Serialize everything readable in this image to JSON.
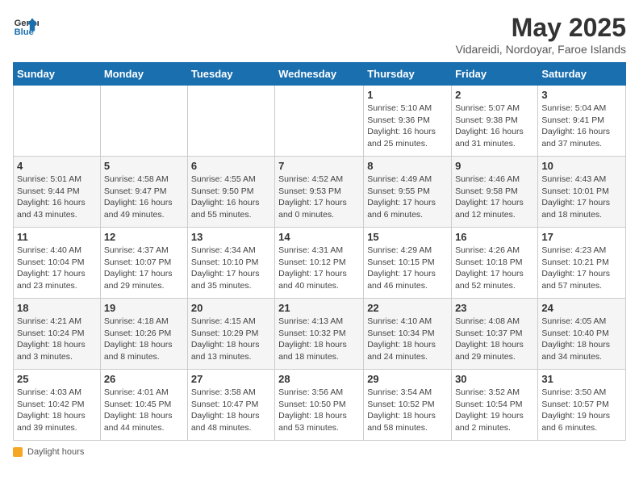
{
  "logo": {
    "line1": "General",
    "line2": "Blue"
  },
  "title": "May 2025",
  "subtitle": "Vidareidi, Nordoyar, Faroe Islands",
  "weekdays": [
    "Sunday",
    "Monday",
    "Tuesday",
    "Wednesday",
    "Thursday",
    "Friday",
    "Saturday"
  ],
  "weeks": [
    [
      {
        "day": "",
        "info": ""
      },
      {
        "day": "",
        "info": ""
      },
      {
        "day": "",
        "info": ""
      },
      {
        "day": "",
        "info": ""
      },
      {
        "day": "1",
        "info": "Sunrise: 5:10 AM\nSunset: 9:36 PM\nDaylight: 16 hours\nand 25 minutes."
      },
      {
        "day": "2",
        "info": "Sunrise: 5:07 AM\nSunset: 9:38 PM\nDaylight: 16 hours\nand 31 minutes."
      },
      {
        "day": "3",
        "info": "Sunrise: 5:04 AM\nSunset: 9:41 PM\nDaylight: 16 hours\nand 37 minutes."
      }
    ],
    [
      {
        "day": "4",
        "info": "Sunrise: 5:01 AM\nSunset: 9:44 PM\nDaylight: 16 hours\nand 43 minutes."
      },
      {
        "day": "5",
        "info": "Sunrise: 4:58 AM\nSunset: 9:47 PM\nDaylight: 16 hours\nand 49 minutes."
      },
      {
        "day": "6",
        "info": "Sunrise: 4:55 AM\nSunset: 9:50 PM\nDaylight: 16 hours\nand 55 minutes."
      },
      {
        "day": "7",
        "info": "Sunrise: 4:52 AM\nSunset: 9:53 PM\nDaylight: 17 hours\nand 0 minutes."
      },
      {
        "day": "8",
        "info": "Sunrise: 4:49 AM\nSunset: 9:55 PM\nDaylight: 17 hours\nand 6 minutes."
      },
      {
        "day": "9",
        "info": "Sunrise: 4:46 AM\nSunset: 9:58 PM\nDaylight: 17 hours\nand 12 minutes."
      },
      {
        "day": "10",
        "info": "Sunrise: 4:43 AM\nSunset: 10:01 PM\nDaylight: 17 hours\nand 18 minutes."
      }
    ],
    [
      {
        "day": "11",
        "info": "Sunrise: 4:40 AM\nSunset: 10:04 PM\nDaylight: 17 hours\nand 23 minutes."
      },
      {
        "day": "12",
        "info": "Sunrise: 4:37 AM\nSunset: 10:07 PM\nDaylight: 17 hours\nand 29 minutes."
      },
      {
        "day": "13",
        "info": "Sunrise: 4:34 AM\nSunset: 10:10 PM\nDaylight: 17 hours\nand 35 minutes."
      },
      {
        "day": "14",
        "info": "Sunrise: 4:31 AM\nSunset: 10:12 PM\nDaylight: 17 hours\nand 40 minutes."
      },
      {
        "day": "15",
        "info": "Sunrise: 4:29 AM\nSunset: 10:15 PM\nDaylight: 17 hours\nand 46 minutes."
      },
      {
        "day": "16",
        "info": "Sunrise: 4:26 AM\nSunset: 10:18 PM\nDaylight: 17 hours\nand 52 minutes."
      },
      {
        "day": "17",
        "info": "Sunrise: 4:23 AM\nSunset: 10:21 PM\nDaylight: 17 hours\nand 57 minutes."
      }
    ],
    [
      {
        "day": "18",
        "info": "Sunrise: 4:21 AM\nSunset: 10:24 PM\nDaylight: 18 hours\nand 3 minutes."
      },
      {
        "day": "19",
        "info": "Sunrise: 4:18 AM\nSunset: 10:26 PM\nDaylight: 18 hours\nand 8 minutes."
      },
      {
        "day": "20",
        "info": "Sunrise: 4:15 AM\nSunset: 10:29 PM\nDaylight: 18 hours\nand 13 minutes."
      },
      {
        "day": "21",
        "info": "Sunrise: 4:13 AM\nSunset: 10:32 PM\nDaylight: 18 hours\nand 18 minutes."
      },
      {
        "day": "22",
        "info": "Sunrise: 4:10 AM\nSunset: 10:34 PM\nDaylight: 18 hours\nand 24 minutes."
      },
      {
        "day": "23",
        "info": "Sunrise: 4:08 AM\nSunset: 10:37 PM\nDaylight: 18 hours\nand 29 minutes."
      },
      {
        "day": "24",
        "info": "Sunrise: 4:05 AM\nSunset: 10:40 PM\nDaylight: 18 hours\nand 34 minutes."
      }
    ],
    [
      {
        "day": "25",
        "info": "Sunrise: 4:03 AM\nSunset: 10:42 PM\nDaylight: 18 hours\nand 39 minutes."
      },
      {
        "day": "26",
        "info": "Sunrise: 4:01 AM\nSunset: 10:45 PM\nDaylight: 18 hours\nand 44 minutes."
      },
      {
        "day": "27",
        "info": "Sunrise: 3:58 AM\nSunset: 10:47 PM\nDaylight: 18 hours\nand 48 minutes."
      },
      {
        "day": "28",
        "info": "Sunrise: 3:56 AM\nSunset: 10:50 PM\nDaylight: 18 hours\nand 53 minutes."
      },
      {
        "day": "29",
        "info": "Sunrise: 3:54 AM\nSunset: 10:52 PM\nDaylight: 18 hours\nand 58 minutes."
      },
      {
        "day": "30",
        "info": "Sunrise: 3:52 AM\nSunset: 10:54 PM\nDaylight: 19 hours\nand 2 minutes."
      },
      {
        "day": "31",
        "info": "Sunrise: 3:50 AM\nSunset: 10:57 PM\nDaylight: 19 hours\nand 6 minutes."
      }
    ]
  ],
  "footer": {
    "daylight_label": "Daylight hours"
  }
}
